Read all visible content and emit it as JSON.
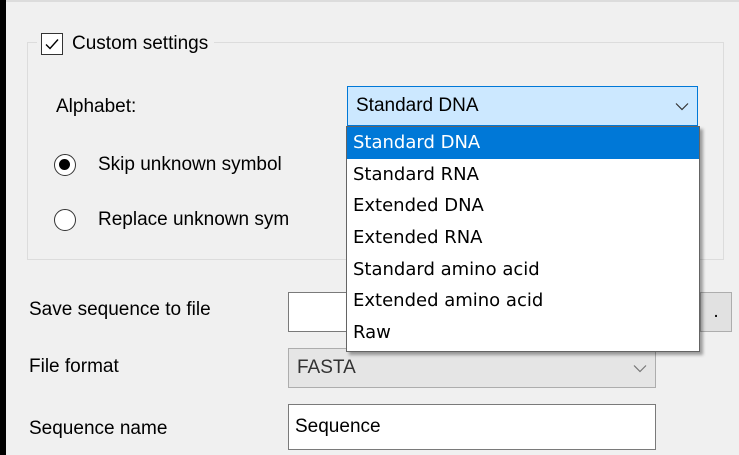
{
  "custom_settings": {
    "label": "Custom settings",
    "checked": true
  },
  "alphabet": {
    "label": "Alphabet:",
    "selected": "Standard DNA",
    "options": [
      "Standard DNA",
      "Standard RNA",
      "Extended DNA",
      "Extended RNA",
      "Standard amino acid",
      "Extended amino acid",
      "Raw"
    ],
    "highlighted_index": 0
  },
  "unknown_symbols": {
    "skip_label": "Skip unknown symbol",
    "replace_label": "Replace unknown sym",
    "selected": "skip"
  },
  "save_to_file": {
    "label": "Save sequence to file",
    "value": "",
    "browse_label": "."
  },
  "file_format": {
    "label": "File format",
    "selected": "FASTA"
  },
  "sequence_name": {
    "label": "Sequence name",
    "value": "Sequence"
  },
  "colors": {
    "accent": "#0078d7",
    "combo_focus_bg": "#cce8ff",
    "window_bg": "#f0f0f0"
  },
  "icons": {
    "checkbox": "checkmark-icon",
    "dropdown": "chevron-down-icon"
  }
}
